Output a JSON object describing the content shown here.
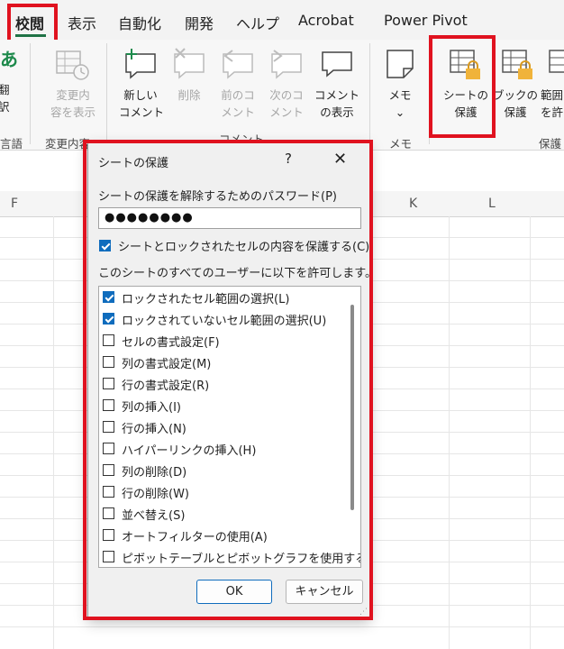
{
  "tabs": [
    "校閲",
    "表示",
    "自動化",
    "開発",
    "ヘルプ",
    "Acrobat",
    "Power Pivot"
  ],
  "ribbon": {
    "partial_left": {
      "glyph": "あ",
      "lines": [
        "翻",
        "訳"
      ],
      "group": "言語"
    },
    "changes_btn": {
      "lines": [
        "変更内",
        "容を表示"
      ],
      "group": "変更内容"
    },
    "comment_buttons": [
      {
        "lines": [
          "新しい",
          "コメント"
        ]
      },
      {
        "lines": [
          "削除"
        ]
      },
      {
        "lines": [
          "前のコ",
          "メント"
        ]
      },
      {
        "lines": [
          "次のコ",
          "メント"
        ]
      },
      {
        "lines": [
          "コメント",
          "の表示"
        ]
      }
    ],
    "comments_group": "コメント",
    "memo_btn": {
      "lines": [
        "メモ",
        "⌄"
      ],
      "group": "メモ"
    },
    "protect_buttons": [
      {
        "lines": [
          "シートの",
          "保護"
        ]
      },
      {
        "lines": [
          "ブックの",
          "保護"
        ]
      },
      {
        "lines": [
          "範囲",
          "を許"
        ]
      }
    ],
    "protect_group": "保護"
  },
  "columns": [
    "F",
    "K",
    "L"
  ],
  "dialog": {
    "title": "シートの保護",
    "help": "?",
    "close": "✕",
    "password_label": "シートの保護を解除するためのパスワード(P)",
    "password_value": "●●●●●●●●",
    "protect_checkbox_label": "シートとロックされたセルの内容を保護する(C)",
    "protect_checked": true,
    "allow_label": "このシートのすべてのユーザーに以下を許可します。",
    "permissions": [
      {
        "label": "ロックされたセル範囲の選択(L)",
        "checked": true
      },
      {
        "label": "ロックされていないセル範囲の選択(U)",
        "checked": true
      },
      {
        "label": "セルの書式設定(F)",
        "checked": false
      },
      {
        "label": "列の書式設定(M)",
        "checked": false
      },
      {
        "label": "行の書式設定(R)",
        "checked": false
      },
      {
        "label": "列の挿入(I)",
        "checked": false
      },
      {
        "label": "行の挿入(N)",
        "checked": false
      },
      {
        "label": "ハイパーリンクの挿入(H)",
        "checked": false
      },
      {
        "label": "列の削除(D)",
        "checked": false
      },
      {
        "label": "行の削除(W)",
        "checked": false
      },
      {
        "label": "並べ替え(S)",
        "checked": false
      },
      {
        "label": "オートフィルターの使用(A)",
        "checked": false
      },
      {
        "label": "ピボットテーブルとピボットグラフを使用する",
        "checked": false
      }
    ],
    "ok": "OK",
    "cancel": "キャンセル"
  },
  "colors": {
    "highlight": "#e0121f",
    "accent": "#0f6cbd",
    "excel_green": "#1e7145"
  }
}
